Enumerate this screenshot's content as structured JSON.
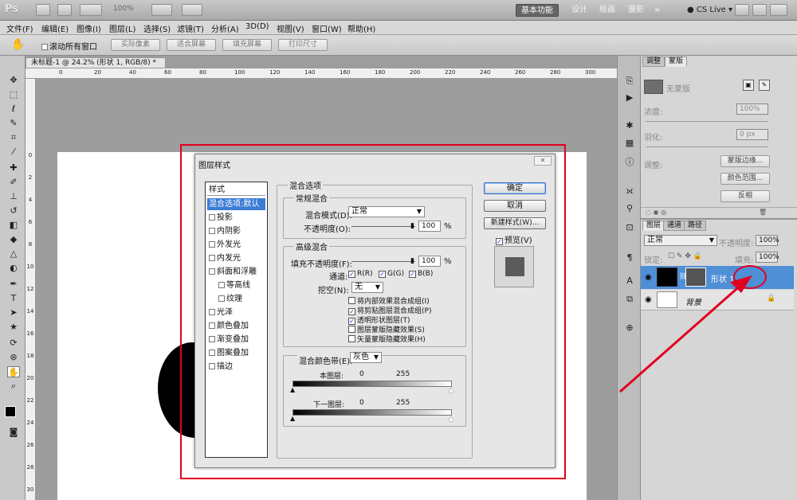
{
  "app": {
    "logo": "Ps",
    "zoom": "100%",
    "workspaces": [
      "基本功能",
      "设计",
      "绘画",
      "摄影"
    ],
    "more": "»",
    "cslive": "CS Live"
  },
  "menu": [
    "文件(F)",
    "编辑(E)",
    "图像(I)",
    "图层(L)",
    "选择(S)",
    "滤镜(T)",
    "分析(A)",
    "3D(D)",
    "视图(V)",
    "窗口(W)",
    "帮助(H)"
  ],
  "options": {
    "scroll_all": "滚动所有窗口",
    "buttons": [
      "实际像素",
      "适合屏幕",
      "填充屏幕",
      "打印尺寸"
    ]
  },
  "document": {
    "tab_title": "未标题-1 @ 24.2% (形状 1, RGB/8) *",
    "ruler_h": [
      "0",
      "20",
      "40",
      "60",
      "80",
      "100",
      "120",
      "140",
      "160",
      "180",
      "200",
      "220",
      "240",
      "260",
      "280",
      "300"
    ],
    "ruler_v": [
      "0",
      "2",
      "4",
      "6",
      "8",
      "10",
      "12",
      "14",
      "16",
      "18",
      "20",
      "22",
      "24",
      "26",
      "28",
      "30"
    ]
  },
  "dialog": {
    "title": "图层样式",
    "close": "✕",
    "styles_header": "样式",
    "styles": [
      {
        "label": "混合选项:默认",
        "selected": true,
        "check": false,
        "indent": false
      },
      {
        "label": "投影",
        "check": true,
        "indent": false
      },
      {
        "label": "内阴影",
        "check": true,
        "indent": false
      },
      {
        "label": "外发光",
        "check": true,
        "indent": false
      },
      {
        "label": "内发光",
        "check": true,
        "indent": false
      },
      {
        "label": "斜面和浮雕",
        "check": true,
        "indent": false
      },
      {
        "label": "等高线",
        "check": true,
        "indent": true
      },
      {
        "label": "纹理",
        "check": true,
        "indent": true
      },
      {
        "label": "光泽",
        "check": true,
        "indent": false
      },
      {
        "label": "颜色叠加",
        "check": true,
        "indent": false
      },
      {
        "label": "渐变叠加",
        "check": true,
        "indent": false
      },
      {
        "label": "图案叠加",
        "check": true,
        "indent": false
      },
      {
        "label": "描边",
        "check": true,
        "indent": false
      }
    ],
    "blend_options": "混合选项",
    "general_blend": "常规混合",
    "blend_mode_label": "混合模式(D):",
    "blend_mode_value": "正常",
    "opacity_label": "不透明度(O):",
    "opacity_value": "100",
    "percent": "%",
    "advanced_blend": "高级混合",
    "fill_opacity_label": "填充不透明度(F):",
    "fill_opacity_value": "100",
    "channels_label": "通道:",
    "channel_r": "R(R)",
    "channel_g": "G(G)",
    "channel_b": "B(B)",
    "knockout_label": "挖空(N):",
    "knockout_value": "无",
    "adv_checks": [
      {
        "label": "将内部效果混合成组(I)",
        "checked": false
      },
      {
        "label": "将剪贴图层混合成组(P)",
        "checked": true
      },
      {
        "label": "透明形状图层(T)",
        "checked": true
      },
      {
        "label": "图层蒙版隐藏效果(S)",
        "checked": false
      },
      {
        "label": "矢量蒙版隐藏效果(H)",
        "checked": false
      }
    ],
    "blend_if_label": "混合颜色带(E):",
    "blend_if_value": "灰色",
    "this_layer": "本图层:",
    "under_layer": "下一图层:",
    "val_min": "0",
    "val_max": "255",
    "ok": "确定",
    "cancel": "取消",
    "new_style": "新建样式(W)...",
    "preview": "预览(V)"
  },
  "masks_panel": {
    "tabs": [
      "调整",
      "蒙版"
    ],
    "no_mask": "无蒙版",
    "density": "浓度:",
    "density_value": "100%",
    "feather": "羽化:",
    "feather_value": "0 px",
    "refine": "调整:",
    "btn_edge": "蒙版边缘...",
    "btn_range": "颜色范围...",
    "btn_invert": "反相"
  },
  "layers_panel": {
    "tabs": [
      "图层",
      "通道",
      "路径"
    ],
    "blend": "正常",
    "opacity_label": "不透明度:",
    "opacity_value": "100%",
    "lock_label": "锁定:",
    "fill_label": "填充:",
    "fill_value": "100%",
    "layers": [
      {
        "name": "形状 1"
      },
      {
        "name": "背景"
      }
    ]
  }
}
